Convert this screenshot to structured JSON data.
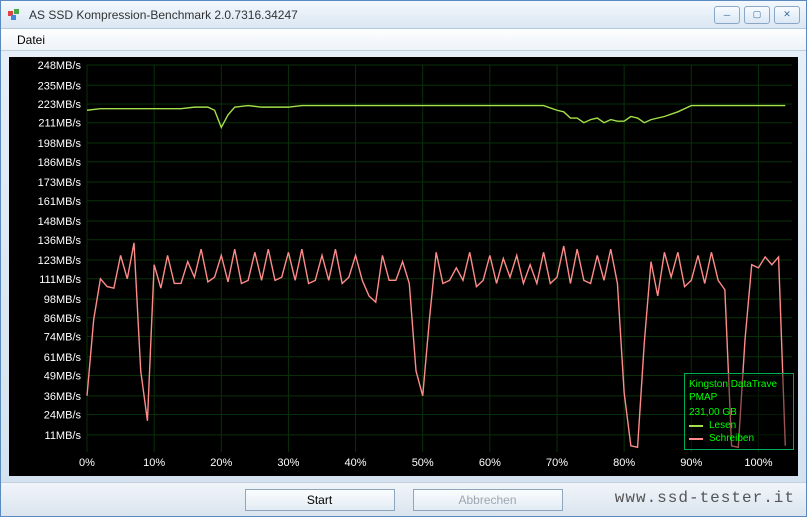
{
  "window": {
    "title": "AS SSD Kompression-Benchmark 2.0.7316.34247"
  },
  "menu": {
    "datei": "Datei"
  },
  "buttons": {
    "start": "Start",
    "cancel": "Abbrechen"
  },
  "legend": {
    "device": "Kingston DataTrave",
    "mode": "PMAP",
    "size": "231,00 GB",
    "read": "Lesen",
    "write": "Schreiben"
  },
  "watermark": "www.ssd-tester.it",
  "chart_data": {
    "type": "line",
    "xlabel": "",
    "ylabel": "",
    "xlim": [
      0,
      105
    ],
    "ylim": [
      0,
      248
    ],
    "x_ticks": [
      "0%",
      "10%",
      "20%",
      "30%",
      "40%",
      "50%",
      "60%",
      "70%",
      "80%",
      "90%",
      "100%"
    ],
    "y_ticks": [
      "11MB/s",
      "24MB/s",
      "36MB/s",
      "49MB/s",
      "61MB/s",
      "74MB/s",
      "86MB/s",
      "98MB/s",
      "111MB/s",
      "123MB/s",
      "136MB/s",
      "148MB/s",
      "161MB/s",
      "173MB/s",
      "186MB/s",
      "198MB/s",
      "211MB/s",
      "223MB/s",
      "235MB/s",
      "248MB/s"
    ],
    "series": [
      {
        "name": "Lesen",
        "color": "#a4e04a",
        "x": [
          0,
          2,
          4,
          6,
          8,
          10,
          12,
          14,
          16,
          18,
          19,
          20,
          21,
          22,
          24,
          26,
          28,
          30,
          32,
          34,
          36,
          38,
          40,
          42,
          44,
          46,
          48,
          50,
          52,
          54,
          56,
          58,
          60,
          62,
          64,
          66,
          68,
          70,
          71,
          72,
          73,
          74,
          75,
          76,
          77,
          78,
          79,
          80,
          81,
          82,
          83,
          84,
          86,
          88,
          90,
          92,
          94,
          96,
          98,
          100,
          102,
          104
        ],
        "values": [
          219,
          220,
          220,
          220,
          220,
          220,
          220,
          220,
          221,
          221,
          219,
          208,
          216,
          221,
          222,
          221,
          221,
          221,
          222,
          222,
          222,
          222,
          222,
          222,
          222,
          222,
          222,
          222,
          222,
          222,
          222,
          222,
          222,
          222,
          222,
          222,
          222,
          219,
          218,
          214,
          214,
          211,
          213,
          214,
          211,
          213,
          212,
          212,
          215,
          214,
          211,
          213,
          215,
          218,
          222,
          222,
          222,
          222,
          222,
          222,
          222,
          222
        ]
      },
      {
        "name": "Schreiben",
        "color": "#ff8a8a",
        "x": [
          0,
          1,
          2,
          3,
          4,
          5,
          6,
          7,
          8,
          9,
          10,
          11,
          12,
          13,
          14,
          15,
          16,
          17,
          18,
          19,
          20,
          21,
          22,
          23,
          24,
          25,
          26,
          27,
          28,
          29,
          30,
          31,
          32,
          33,
          34,
          35,
          36,
          37,
          38,
          39,
          40,
          41,
          42,
          43,
          44,
          45,
          46,
          47,
          48,
          49,
          50,
          51,
          52,
          53,
          54,
          55,
          56,
          57,
          58,
          59,
          60,
          61,
          62,
          63,
          64,
          65,
          66,
          67,
          68,
          69,
          70,
          71,
          72,
          73,
          74,
          75,
          76,
          77,
          78,
          79,
          80,
          81,
          82,
          83,
          84,
          85,
          86,
          87,
          88,
          89,
          90,
          91,
          92,
          93,
          94,
          95,
          96,
          97,
          98,
          99,
          100,
          101,
          102,
          103,
          104
        ],
        "values": [
          36,
          85,
          111,
          106,
          105,
          126,
          111,
          134,
          52,
          20,
          120,
          105,
          126,
          108,
          108,
          122,
          112,
          130,
          109,
          112,
          126,
          109,
          130,
          108,
          110,
          128,
          110,
          130,
          110,
          112,
          128,
          110,
          130,
          108,
          110,
          126,
          110,
          130,
          108,
          112,
          126,
          110,
          100,
          96,
          126,
          110,
          110,
          122,
          108,
          52,
          36,
          85,
          128,
          108,
          110,
          118,
          110,
          128,
          106,
          110,
          126,
          108,
          124,
          112,
          126,
          108,
          120,
          108,
          128,
          108,
          112,
          132,
          108,
          130,
          110,
          108,
          126,
          110,
          130,
          108,
          38,
          4,
          3,
          70,
          122,
          100,
          128,
          112,
          128,
          106,
          110,
          126,
          108,
          128,
          110,
          104,
          4,
          3,
          72,
          120,
          118,
          125,
          120,
          125,
          4
        ]
      }
    ]
  }
}
